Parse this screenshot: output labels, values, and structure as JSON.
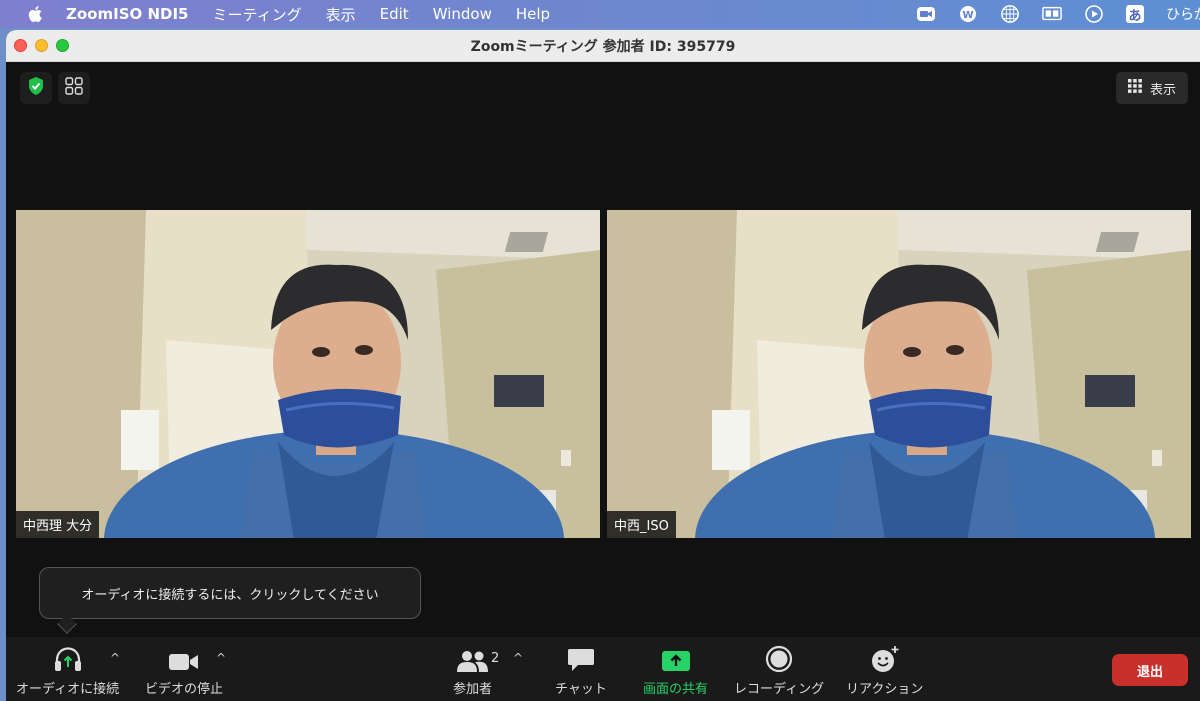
{
  "menubar": {
    "app_name": "ZoomISO NDI5",
    "items": [
      "ミーティング",
      "表示",
      "Edit",
      "Window",
      "Help"
    ],
    "ime_label": "あ",
    "ime_text": "ひらが"
  },
  "window": {
    "title": "Zoomミーティング 参加者 ID: 395779"
  },
  "stage": {
    "view_label": "表示",
    "participants": [
      {
        "name": "中西理 大分"
      },
      {
        "name": "中西_ISO"
      }
    ],
    "tooltip": "オーディオに接続するには、クリックしてください"
  },
  "toolbar": {
    "audio_label": "オーディオに接続",
    "video_label": "ビデオの停止",
    "participants_label": "参加者",
    "participants_count": "2",
    "chat_label": "チャット",
    "share_label": "画面の共有",
    "record_label": "レコーディング",
    "reactions_label": "リアクション",
    "leave_label": "退出",
    "caret": "^"
  },
  "colors": {
    "share_green": "#25d366",
    "leave_red": "#c9302c",
    "security_green": "#1fbf4a"
  }
}
